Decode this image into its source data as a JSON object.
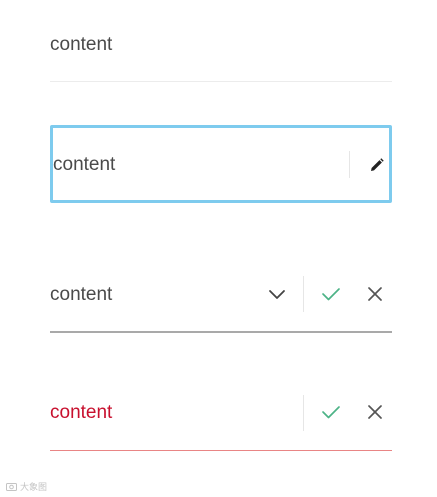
{
  "fields": [
    {
      "value": "content",
      "state": "read-only"
    },
    {
      "value": "content",
      "state": "focused",
      "action_icon": "edit-icon"
    },
    {
      "value": "content",
      "state": "editing-dropdown",
      "dropdown_icon": "chevron-down-icon",
      "confirm_icon": "check-icon",
      "cancel_icon": "close-icon"
    },
    {
      "value": "content",
      "state": "error",
      "confirm_icon": "check-icon",
      "cancel_icon": "close-icon"
    }
  ],
  "colors": {
    "text": "#4a4a4a",
    "focus_border": "#7ecbee",
    "error_text": "#c8102e",
    "error_underline": "#e98585",
    "confirm": "#4cb387",
    "cancel": "#555555",
    "underline": "#a9a9a9"
  },
  "watermark": {
    "icon": "camera-icon",
    "text": "大象图"
  }
}
